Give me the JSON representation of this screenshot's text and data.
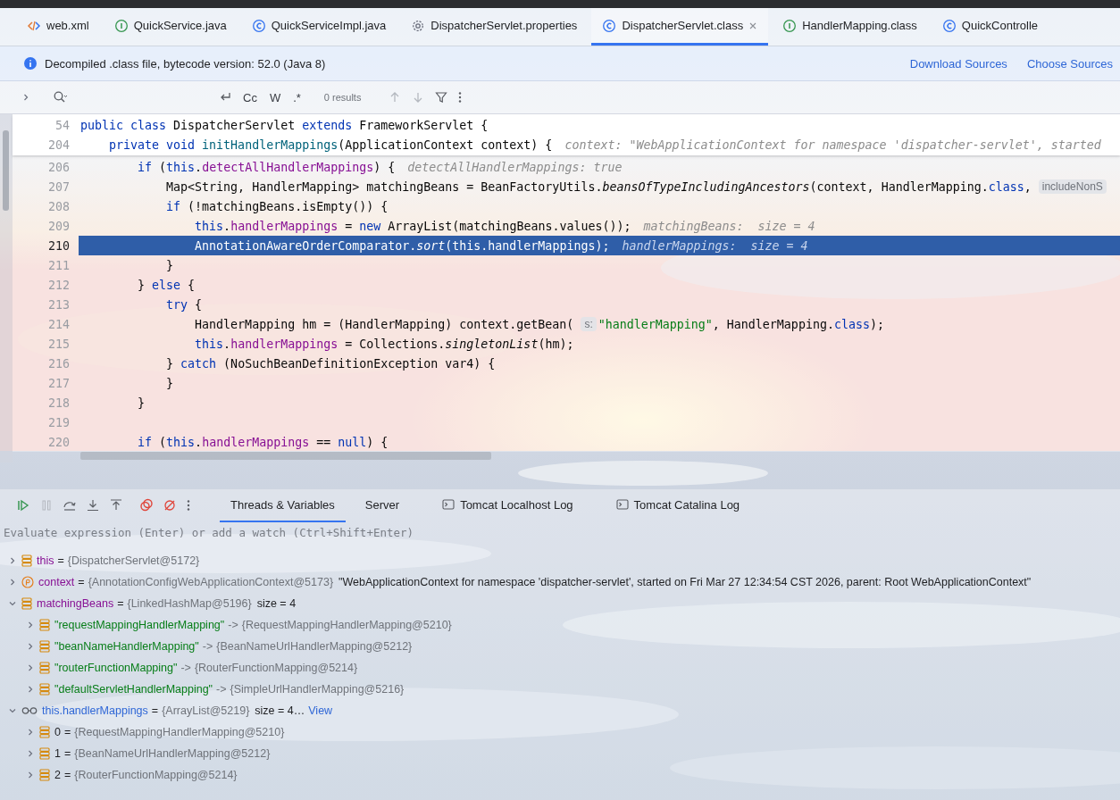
{
  "tabs": [
    {
      "label": "web.xml",
      "kind": "xml",
      "selected": false
    },
    {
      "label": "QuickService.java",
      "kind": "interface",
      "selected": false
    },
    {
      "label": "QuickServiceImpl.java",
      "kind": "class",
      "selected": false
    },
    {
      "label": "DispatcherServlet.properties",
      "kind": "properties",
      "selected": false
    },
    {
      "label": "DispatcherServlet.class",
      "kind": "class",
      "selected": true
    },
    {
      "label": "HandlerMapping.class",
      "kind": "interface",
      "selected": false
    },
    {
      "label": "QuickControlle",
      "kind": "class",
      "selected": false
    }
  ],
  "notice": {
    "text": "Decompiled .class file, bytecode version: 52.0 (Java 8)",
    "links": [
      "Download Sources",
      "Choose Sources"
    ]
  },
  "find_bar": {
    "options": [
      "Cc",
      "W",
      ".*"
    ],
    "results": "0 results"
  },
  "editor": {
    "sticky_lines": [
      {
        "number": "54",
        "tokens": [
          {
            "kind": "keyword",
            "text": "public class "
          },
          {
            "kind": "plain",
            "text": "DispatcherServlet "
          },
          {
            "kind": "keyword",
            "text": "extends "
          },
          {
            "kind": "plain",
            "text": "FrameworkServlet {"
          }
        ]
      },
      {
        "number": "204",
        "tokens": [
          {
            "kind": "keyword",
            "text": "    private void "
          },
          {
            "kind": "decl",
            "text": "initHandlerMappings"
          },
          {
            "kind": "plain",
            "text": "(ApplicationContext context) {"
          },
          {
            "kind": "hint",
            "text": "context: \"WebApplicationContext for namespace 'dispatcher-servlet', started"
          }
        ]
      }
    ],
    "lines": [
      {
        "number": "206",
        "selected": false,
        "tokens": [
          {
            "kind": "keyword",
            "text": "        if"
          },
          {
            "kind": "plain",
            "text": " ("
          },
          {
            "kind": "keyword",
            "text": "this"
          },
          {
            "kind": "plain",
            "text": "."
          },
          {
            "kind": "field",
            "text": "detectAllHandlerMappings"
          },
          {
            "kind": "plain",
            "text": ") {"
          },
          {
            "kind": "hint",
            "text": "detectAllHandlerMappings: true"
          }
        ]
      },
      {
        "number": "207",
        "selected": false,
        "tokens": [
          {
            "kind": "plain",
            "text": "            Map<String, HandlerMapping> matchingBeans = BeanFactoryUtils."
          },
          {
            "kind": "static",
            "text": "beansOfTypeIncludingAncestors"
          },
          {
            "kind": "plain",
            "text": "(context, HandlerMapping."
          },
          {
            "kind": "keyword",
            "text": "class"
          },
          {
            "kind": "plain",
            "text": ","
          },
          {
            "kind": "chip",
            "text": "includeNonS"
          }
        ]
      },
      {
        "number": "208",
        "selected": false,
        "tokens": [
          {
            "kind": "keyword",
            "text": "            if"
          },
          {
            "kind": "plain",
            "text": " (!matchingBeans.isEmpty()) {"
          }
        ]
      },
      {
        "number": "209",
        "selected": false,
        "tokens": [
          {
            "kind": "keyword",
            "text": "                this"
          },
          {
            "kind": "plain",
            "text": "."
          },
          {
            "kind": "field",
            "text": "handlerMappings"
          },
          {
            "kind": "plain",
            "text": " = "
          },
          {
            "kind": "keyword",
            "text": "new"
          },
          {
            "kind": "plain",
            "text": " ArrayList(matchingBeans.values());"
          },
          {
            "kind": "hint",
            "text": "matchingBeans:  size = 4"
          }
        ]
      },
      {
        "number": "210",
        "selected": true,
        "tokens": [
          {
            "kind": "plain",
            "text": "                AnnotationAwareOrderComparator."
          },
          {
            "kind": "static",
            "text": "sort"
          },
          {
            "kind": "plain",
            "text": "(this.handlerMappings);"
          },
          {
            "kind": "hint",
            "text": "handlerMappings:  size = 4"
          }
        ]
      },
      {
        "number": "211",
        "selected": false,
        "tokens": [
          {
            "kind": "plain",
            "text": "            }"
          }
        ]
      },
      {
        "number": "212",
        "selected": false,
        "tokens": [
          {
            "kind": "plain",
            "text": "        } "
          },
          {
            "kind": "keyword",
            "text": "else"
          },
          {
            "kind": "plain",
            "text": " {"
          }
        ]
      },
      {
        "number": "213",
        "selected": false,
        "tokens": [
          {
            "kind": "keyword",
            "text": "            try"
          },
          {
            "kind": "plain",
            "text": " {"
          }
        ]
      },
      {
        "number": "214",
        "selected": false,
        "tokens": [
          {
            "kind": "plain",
            "text": "                HandlerMapping hm = (HandlerMapping) context.getBean("
          },
          {
            "kind": "chip",
            "text": "s:"
          },
          {
            "kind": "string",
            "text": "\"handlerMapping\""
          },
          {
            "kind": "plain",
            "text": ", HandlerMapping."
          },
          {
            "kind": "keyword",
            "text": "class"
          },
          {
            "kind": "plain",
            "text": ");"
          }
        ]
      },
      {
        "number": "215",
        "selected": false,
        "tokens": [
          {
            "kind": "keyword",
            "text": "                this"
          },
          {
            "kind": "plain",
            "text": "."
          },
          {
            "kind": "field",
            "text": "handlerMappings"
          },
          {
            "kind": "plain",
            "text": " = Collections."
          },
          {
            "kind": "static",
            "text": "singletonList"
          },
          {
            "kind": "plain",
            "text": "(hm);"
          }
        ]
      },
      {
        "number": "216",
        "selected": false,
        "tokens": [
          {
            "kind": "plain",
            "text": "            } "
          },
          {
            "kind": "keyword",
            "text": "catch"
          },
          {
            "kind": "plain",
            "text": " (NoSuchBeanDefinitionException var4) {"
          }
        ]
      },
      {
        "number": "217",
        "selected": false,
        "tokens": [
          {
            "kind": "plain",
            "text": "            }"
          }
        ]
      },
      {
        "number": "218",
        "selected": false,
        "tokens": [
          {
            "kind": "plain",
            "text": "        }"
          }
        ]
      },
      {
        "number": "219",
        "selected": false
      },
      {
        "number": "220",
        "selected": false,
        "tokens": [
          {
            "kind": "keyword",
            "text": "        if"
          },
          {
            "kind": "plain",
            "text": " ("
          },
          {
            "kind": "keyword",
            "text": "this"
          },
          {
            "kind": "plain",
            "text": "."
          },
          {
            "kind": "field",
            "text": "handlerMappings"
          },
          {
            "kind": "plain",
            "text": " == "
          },
          {
            "kind": "keyword",
            "text": "null"
          },
          {
            "kind": "plain",
            "text": ") {"
          }
        ]
      }
    ]
  },
  "debugger": {
    "tabs": [
      {
        "label": "Threads & Variables",
        "kind": "plain",
        "selected": true
      },
      {
        "label": "Server",
        "kind": "plain",
        "selected": false
      },
      {
        "label": "Tomcat Localhost Log",
        "kind": "console",
        "selected": false
      },
      {
        "label": "Tomcat Catalina Log",
        "kind": "console",
        "selected": false
      }
    ],
    "evaluate_placeholder": "Evaluate expression (Enter) or add a watch (Ctrl+Shift+Enter)",
    "variables": [
      {
        "kind": "field",
        "name": "this",
        "op": "=",
        "value": "{DispatcherServlet@5172}",
        "expanded": false
      },
      {
        "kind": "parameter",
        "name": "context",
        "op": "=",
        "value": "{AnnotationConfigWebApplicationContext@5173}",
        "extra": "\"WebApplicationContext for namespace 'dispatcher-servlet', started on Fri Mar 27 12:34:54 CST 2026, parent: Root WebApplicationContext\"",
        "expanded": false
      },
      {
        "kind": "field",
        "name": "matchingBeans",
        "op": "=",
        "value": "{LinkedHashMap@5196}",
        "extra": "size = 4",
        "expanded": true,
        "children": [
          {
            "kind": "entry",
            "name": "\"requestMappingHandlerMapping\"",
            "op": "->",
            "value": "{RequestMappingHandlerMapping@5210}",
            "expanded": false
          },
          {
            "kind": "entry",
            "name": "\"beanNameHandlerMapping\"",
            "op": "->",
            "value": "{BeanNameUrlHandlerMapping@5212}",
            "expanded": false
          },
          {
            "kind": "entry",
            "name": "\"routerFunctionMapping\"",
            "op": "->",
            "value": "{RouterFunctionMapping@5214}",
            "expanded": false
          },
          {
            "kind": "entry",
            "name": "\"defaultServletHandlerMapping\"",
            "op": "->",
            "value": "{SimpleUrlHandlerMapping@5216}",
            "expanded": false
          }
        ]
      },
      {
        "kind": "watch",
        "name": "this.handlerMappings",
        "op": "=",
        "value": "{ArrayList@5219}",
        "extra": "size = 4…",
        "link": "View",
        "expanded": true,
        "children": [
          {
            "kind": "element",
            "name": "0",
            "op": "=",
            "value": "{RequestMappingHandlerMapping@5210}",
            "expanded": false
          },
          {
            "kind": "element",
            "name": "1",
            "op": "=",
            "value": "{BeanNameUrlHandlerMapping@5212}",
            "expanded": false
          },
          {
            "kind": "element",
            "name": "2",
            "op": "=",
            "value": "{RouterFunctionMapping@5214}",
            "expanded": false
          }
        ]
      }
    ]
  }
}
